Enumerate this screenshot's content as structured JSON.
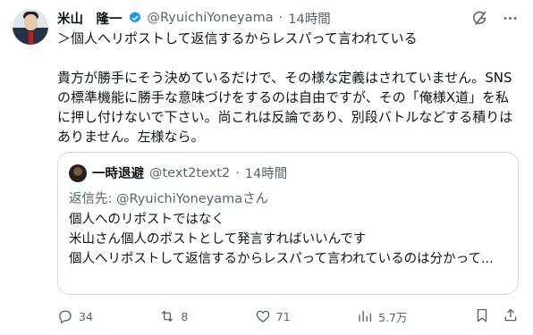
{
  "tweet": {
    "author_name": "米山　隆一",
    "handle": "@RyuichiYoneyama",
    "separator": "·",
    "time": "14時間",
    "body": "＞個人へリポストして返信するからレスパって言われている\n\n貴方が勝手にそう決めているだけで、その様な定義はされていません。SNSの標準機能に勝手な意味づけをするのは自由ですが、その「俺様X道」を私に押し付けないで下さい。尚これは反論であり、別段バトルなどする積りはありません。左様なら。"
  },
  "quote": {
    "author_name": "一時退避",
    "handle": "@text2text2",
    "separator": "·",
    "time": "14時間",
    "reply_prefix": "返信先: ",
    "reply_mention": "@RyuichiYoneyamaさん",
    "text_lines": "個人へのリポストではなく\n米山さん個人のポストとして発言すればいいんです\n",
    "text_truncated_line": "個人へリポストして返信するからレスパって言われているのは分かって..."
  },
  "actions": {
    "replies": "34",
    "reposts": "8",
    "likes": "71",
    "views": "5.7万"
  },
  "icons": {
    "verified": "verified-badge-icon",
    "grok": "grok-icon",
    "more": "more-icon",
    "reply": "reply-icon",
    "repost": "repost-icon",
    "like": "heart-icon",
    "views": "views-icon",
    "bookmark": "bookmark-icon",
    "share": "share-icon"
  },
  "colors": {
    "text": "#0f1419",
    "secondary": "#536471",
    "verified": "#1d9bf0",
    "border": "#cfd9de"
  }
}
